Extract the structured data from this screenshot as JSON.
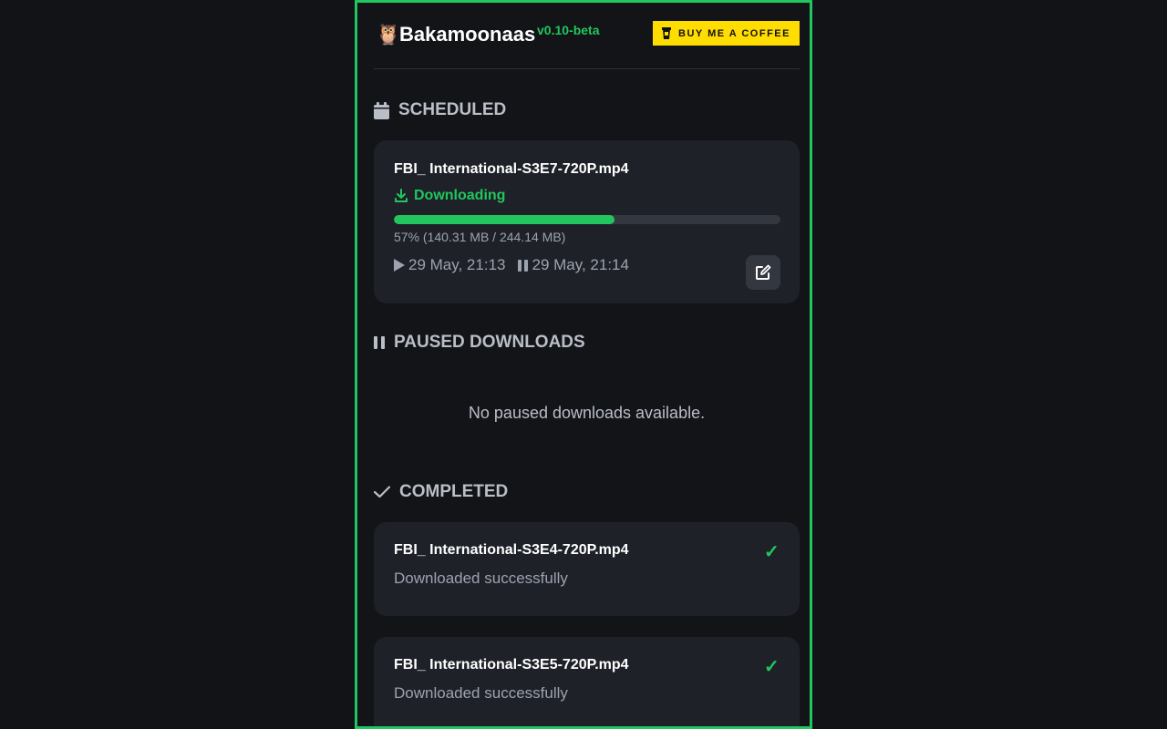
{
  "header": {
    "logo_emoji": "🦉",
    "app_name": "Bakamoonaas",
    "version": "v0.10-beta",
    "coffee_label": "BUY ME A COFFEE"
  },
  "scheduled": {
    "title": "SCHEDULED",
    "item": {
      "filename": "FBI_ International-S3E7-720P.mp4",
      "status": "Downloading",
      "progress_fraction": 0.57,
      "progress_text": "57% (140.31 MB / 244.14 MB)",
      "start_time": "29 May, 21:13",
      "pause_time": "29 May, 21:14"
    }
  },
  "paused": {
    "title": "PAUSED DOWNLOADS",
    "empty_text": "No paused downloads available."
  },
  "completed": {
    "title": "COMPLETED",
    "items": [
      {
        "filename": "FBI_ International-S3E4-720P.mp4",
        "status": "Downloaded successfully",
        "check": "✓"
      },
      {
        "filename": "FBI_ International-S3E5-720P.mp4",
        "status": "Downloaded successfully",
        "check": "✓"
      }
    ]
  },
  "colors": {
    "accent": "#22c55e",
    "coffee": "#ffdd00",
    "card": "#1e2128",
    "background": "#121418"
  }
}
